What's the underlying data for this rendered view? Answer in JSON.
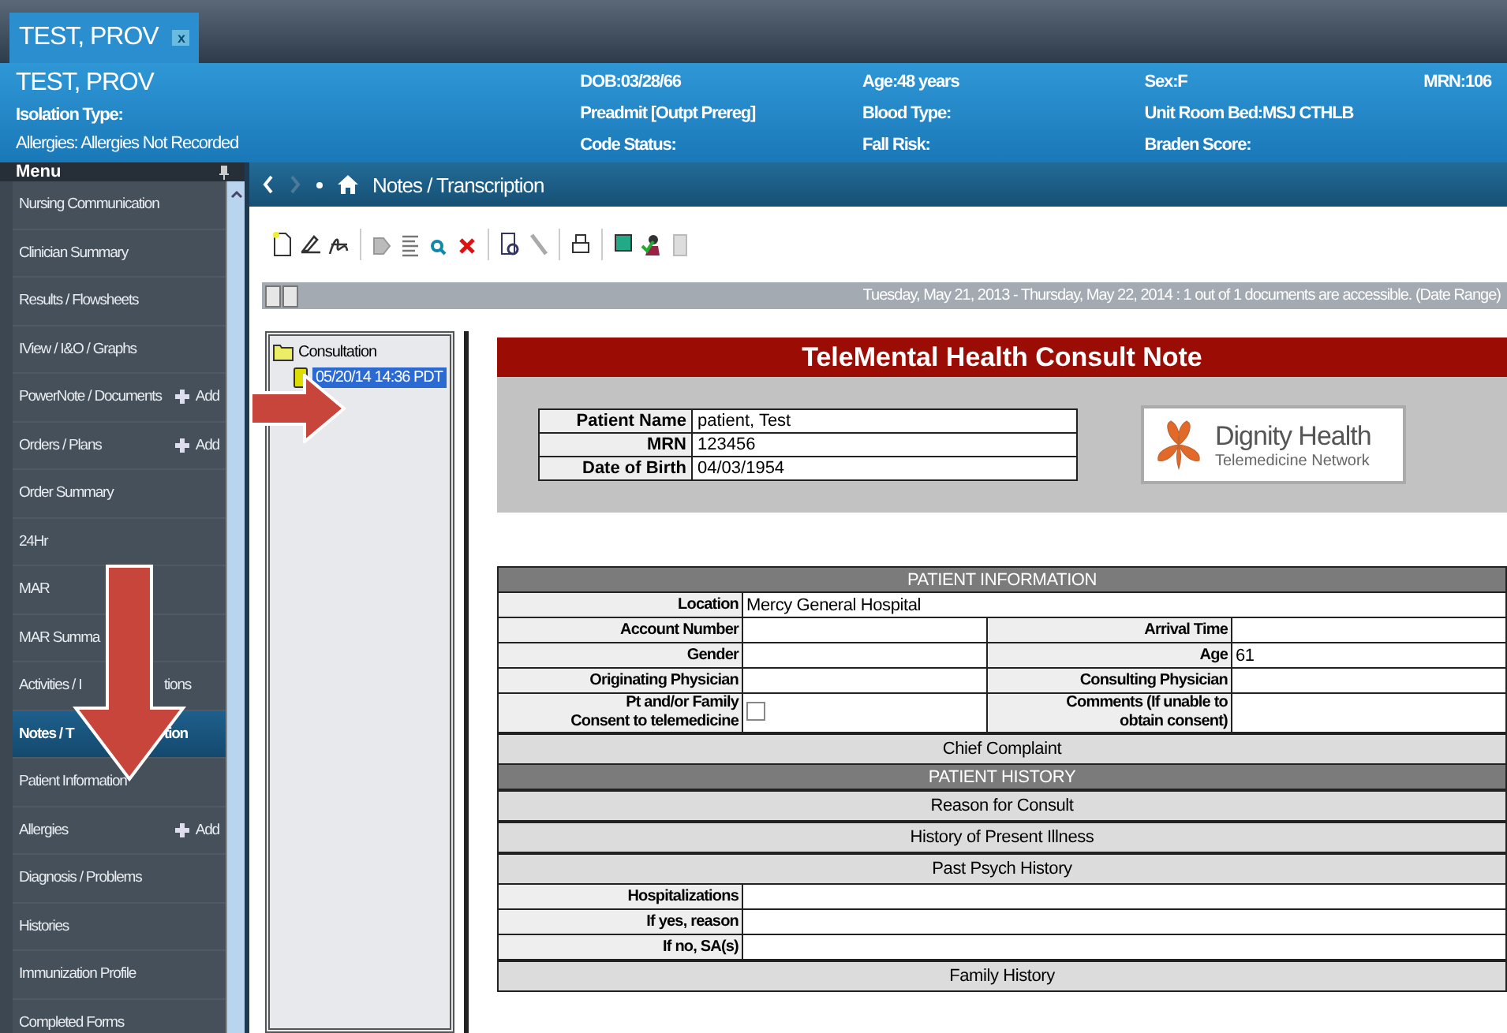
{
  "tab": {
    "title": "TEST, PROV",
    "close": "x"
  },
  "banner": {
    "name": "TEST, PROV",
    "columns": [
      [
        "Isolation Type:",
        "Allergies: Allergies Not Recorded"
      ],
      [
        "DOB:03/28/66",
        "Preadmit [Outpt Prereg]",
        "Code Status:"
      ],
      [
        "Age:48 years",
        "Blood Type:",
        "Fall Risk:"
      ],
      [
        "Sex:F",
        "Unit Room Bed:MSJ CTHLB",
        "Braden Score:"
      ],
      [
        "MRN:106"
      ]
    ]
  },
  "menu": {
    "title": "Menu",
    "items": [
      {
        "label": "Nursing Communication",
        "add": false,
        "selected": false
      },
      {
        "label": "Clinician Summary",
        "add": false,
        "selected": false
      },
      {
        "label": "Results / Flowsheets",
        "add": false,
        "selected": false
      },
      {
        "label": "IView / I&O / Graphs",
        "add": false,
        "selected": false
      },
      {
        "label": "PowerNote / Documents",
        "add": "Add",
        "selected": false
      },
      {
        "label": "Orders / Plans",
        "add": "Add",
        "selected": false
      },
      {
        "label": "Order Summary",
        "add": false,
        "selected": false
      },
      {
        "label": "24Hr",
        "add": false,
        "selected": false
      },
      {
        "label": "MAR",
        "add": false,
        "selected": false
      },
      {
        "label": "MAR Summa",
        "add": false,
        "selected": false
      },
      {
        "label": "Activities / I",
        "tail": "tions",
        "add": false,
        "selected": false
      },
      {
        "label": "Notes / T",
        "tail": "tion",
        "add": false,
        "selected": true
      },
      {
        "label": "Patient Information",
        "add": false,
        "selected": false
      },
      {
        "label": "Allergies",
        "add": "Add",
        "selected": false
      },
      {
        "label": "Diagnosis / Problems",
        "add": false,
        "selected": false
      },
      {
        "label": "Histories",
        "add": false,
        "selected": false
      },
      {
        "label": "Immunization Profile",
        "add": false,
        "selected": false
      },
      {
        "label": "Completed Forms",
        "add": false,
        "selected": false
      }
    ]
  },
  "breadcrumb": "Notes / Transcription",
  "date_range": "Tuesday, May 21, 2013 - Thursday, May 22, 2014 : 1 out of 1 documents are accessible. (Date Range)",
  "tree": [
    {
      "label": "Consultation",
      "children": [
        {
          "label": "05/20/14 14:36 PDT",
          "selected": true
        }
      ]
    }
  ],
  "document": {
    "title": "TeleMental Health Consult Note",
    "patient": [
      {
        "label": "Patient Name",
        "value": "patient, Test"
      },
      {
        "label": "MRN",
        "value": "123456"
      },
      {
        "label": "Date of Birth",
        "value": "04/03/1954"
      }
    ],
    "logo": {
      "name": "Dignity Health",
      "tagline": "Telemedicine Network"
    },
    "rows": [
      {
        "kind": "section",
        "text": "PATIENT INFORMATION"
      },
      {
        "kind": "field",
        "label": "Location",
        "value": "Mercy General Hospital"
      },
      {
        "kind": "pair",
        "label": "Account Number",
        "label2": "Arrival Time"
      },
      {
        "kind": "pair",
        "label": "Gender",
        "label2": "Age",
        "value2": "61"
      },
      {
        "kind": "pair",
        "label": "Originating Physician",
        "label2": "Consulting Physician"
      },
      {
        "kind": "consent",
        "lines": [
          "Pt and/or Family",
          "Consent to telemedicine"
        ],
        "checked": false,
        "lines2": [
          "Comments (If unable to",
          "obtain consent)"
        ]
      },
      {
        "kind": "band",
        "text": "Chief Complaint"
      },
      {
        "kind": "section",
        "text": "PATIENT HISTORY"
      },
      {
        "kind": "band",
        "text": "Reason for Consult"
      },
      {
        "kind": "band",
        "text": "History of Present Illness"
      },
      {
        "kind": "band",
        "text": "Past Psych History"
      },
      {
        "kind": "field",
        "label": "Hospitalizations"
      },
      {
        "kind": "field",
        "label": "If yes, reason"
      },
      {
        "kind": "field",
        "label": "If no, SA(s)"
      },
      {
        "kind": "band",
        "text": "Family History"
      }
    ]
  }
}
